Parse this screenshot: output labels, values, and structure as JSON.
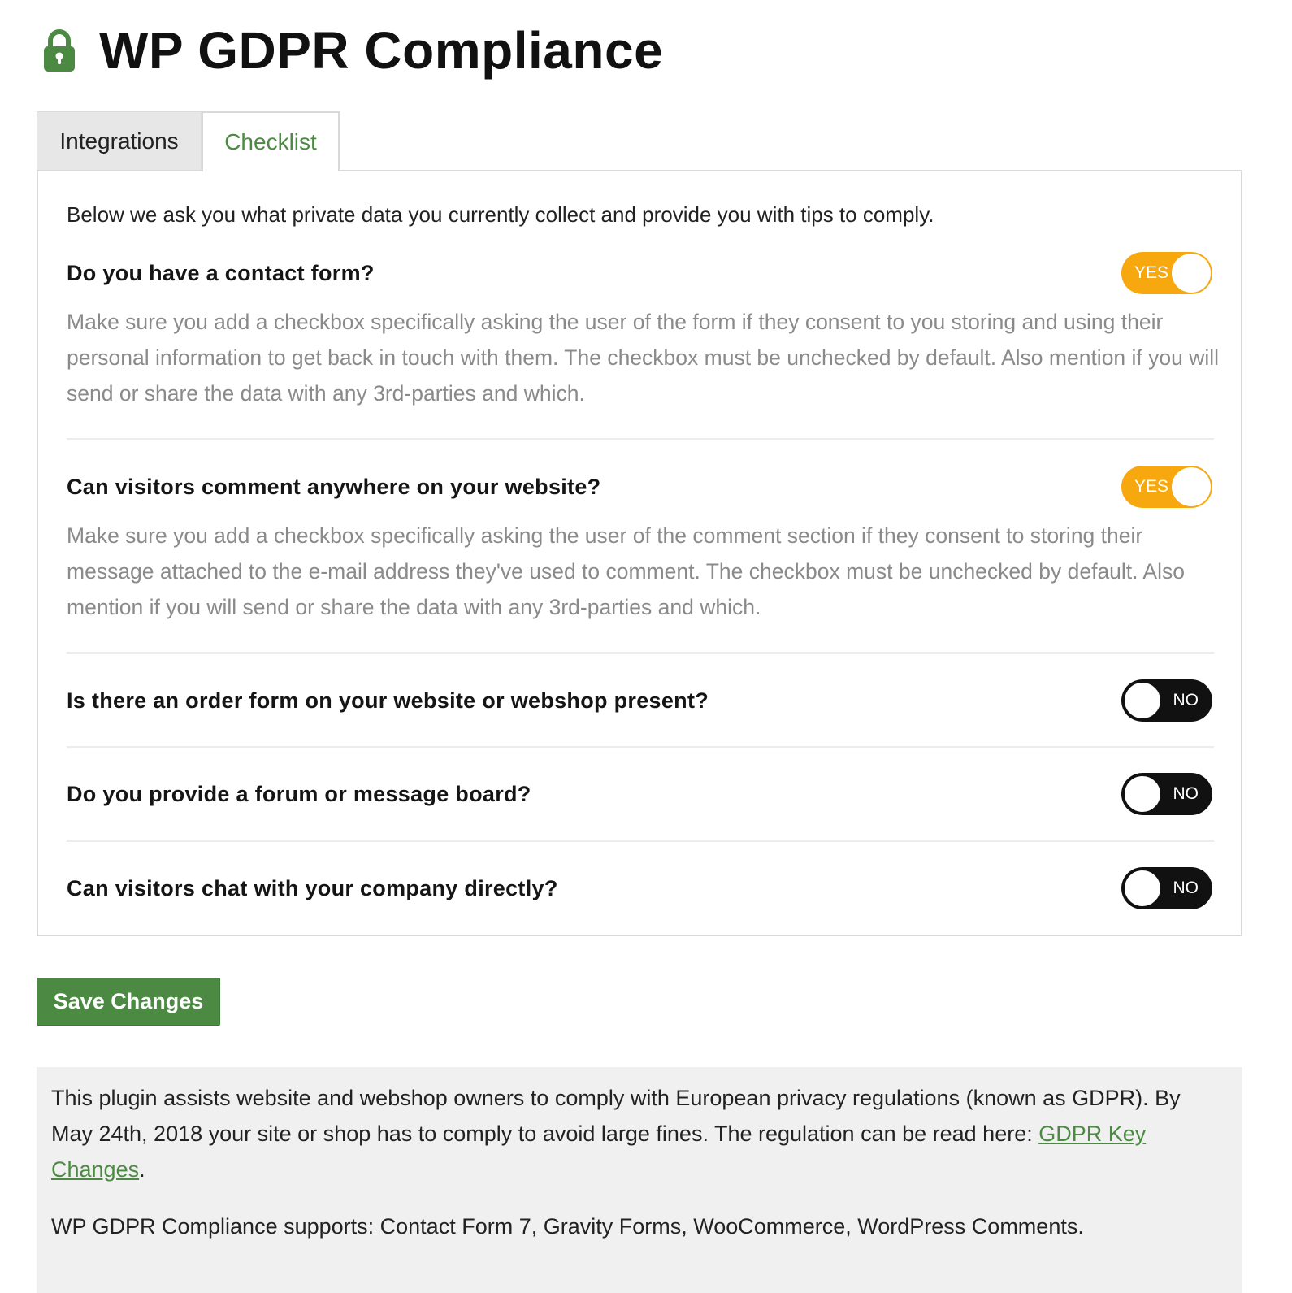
{
  "header": {
    "title": "WP GDPR Compliance",
    "icon": "lock-icon",
    "icon_color": "#4c8a43"
  },
  "tabs": [
    {
      "label": "Integrations",
      "active": false
    },
    {
      "label": "Checklist",
      "active": true
    }
  ],
  "checklist": {
    "intro": "Below we ask you what private data you currently collect and provide you with tips to comply.",
    "items": [
      {
        "question": "Do you have a contact form?",
        "toggle": "YES",
        "description": "Make sure you add a checkbox specifically asking the user of the form if they consent to you storing and using their personal information to get back in touch with them. The checkbox must be unchecked by default. Also mention if you will send or share the data with any 3rd-parties and which."
      },
      {
        "question": "Can visitors comment anywhere on your website?",
        "toggle": "YES",
        "description": "Make sure you add a checkbox specifically asking the user of the comment section if they consent to storing their message attached to the e-mail address they've used to comment. The checkbox must be unchecked by default. Also mention if you will send or share the data with any 3rd-parties and which."
      },
      {
        "question": "Is there an order form on your website or webshop present?",
        "toggle": "NO"
      },
      {
        "question": "Do you provide a forum or message board?",
        "toggle": "NO"
      },
      {
        "question": "Can visitors chat with your company directly?",
        "toggle": "NO"
      }
    ]
  },
  "actions": {
    "save_label": "Save Changes"
  },
  "footer": {
    "text_before_link": "This plugin assists website and webshop owners to comply with European privacy regulations (known as GDPR). By May 24th, 2018 your site or shop has to comply to avoid large fines. The regulation can be read here: ",
    "link_text": "GDPR Key Changes",
    "text_after_link": ".",
    "supports": "WP GDPR Compliance supports: Contact Form 7, Gravity Forms, WooCommerce, WordPress Comments."
  },
  "colors": {
    "accent_green": "#4c8a43",
    "toggle_yes": "#f7a80f",
    "toggle_no": "#111111"
  }
}
